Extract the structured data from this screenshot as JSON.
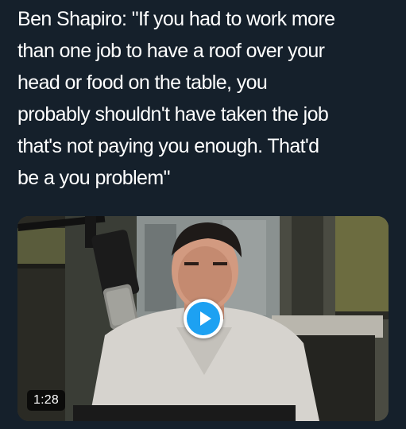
{
  "tweet": {
    "text": "Ben Shapiro: \"If you had to work more\nthan one job to have a roof over your\nhead or food on the table, you\nprobably shouldn't have taken the job\nthat's not paying you enough. That'd\nbe a you problem\""
  },
  "video": {
    "duration": "1:28",
    "play_icon": "play-icon"
  },
  "colors": {
    "background": "#15202b",
    "text": "#ffffff",
    "accent": "#1da1f2"
  }
}
